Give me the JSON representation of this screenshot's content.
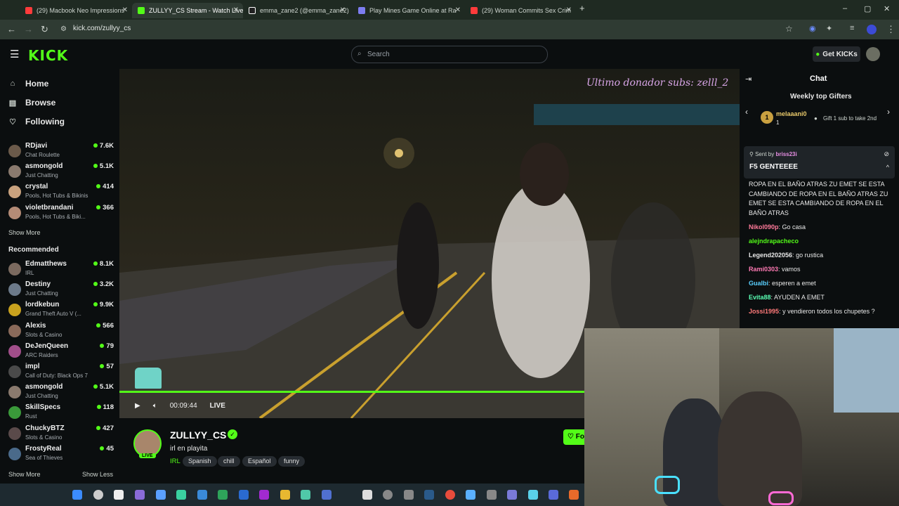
{
  "browser": {
    "tabs": [
      {
        "label": "(29) Macbook Neo Impressions",
        "favicon_color": "#ff3b3b"
      },
      {
        "label": "ZULLYY_CS Stream - Watch Live",
        "favicon_color": "#53fc18"
      },
      {
        "label": "emma_zane2 (@emma_zane2)",
        "favicon_color": "#ffffff"
      },
      {
        "label": "Play Mines Game Online at Ra",
        "favicon_color": "#7d7df0"
      },
      {
        "label": "(29) Woman Commits Sex Crim",
        "favicon_color": "#ff3b3b"
      }
    ],
    "new_tab": "+",
    "url": "kick.com/zullyy_cs",
    "window_controls": [
      "–",
      "▢",
      "✕"
    ]
  },
  "header": {
    "logo": "KICK",
    "search_placeholder": "Search",
    "get_kicks": "Get KICKs"
  },
  "sidebar": {
    "nav": [
      {
        "label": "Home",
        "icon": "home-icon"
      },
      {
        "label": "Browse",
        "icon": "browse-icon"
      },
      {
        "label": "Following",
        "icon": "heart-icon"
      }
    ],
    "following": [
      {
        "name": "RDjavi",
        "category": "Chat Roulette",
        "viewers": "7.6K",
        "color": "#6b5a4a"
      },
      {
        "name": "asmongold",
        "category": "Just Chatting",
        "viewers": "5.1K",
        "color": "#8a7a6e"
      },
      {
        "name": "crystal",
        "category": "Pools, Hot Tubs & Bikinis",
        "viewers": "414",
        "color": "#c9a27e"
      },
      {
        "name": "violetbrandani",
        "category": "Pools, Hot Tubs & Biki...",
        "viewers": "366",
        "color": "#b48b76"
      }
    ],
    "show_more_1": "Show More",
    "recommended_label": "Recommended",
    "recommended": [
      {
        "name": "Edmatthews",
        "category": "IRL",
        "viewers": "8.1K",
        "color": "#7b6a5f"
      },
      {
        "name": "Destiny",
        "category": "Just Chatting",
        "viewers": "3.2K",
        "color": "#6c7a8a"
      },
      {
        "name": "lordkebun",
        "category": "Grand Theft Auto V (...",
        "viewers": "9.9K",
        "color": "#c9a21e"
      },
      {
        "name": "Alexis",
        "category": "Slots & Casino",
        "viewers": "566",
        "color": "#8a6a5a"
      },
      {
        "name": "DeJenQueen",
        "category": "ARC Raiders",
        "viewers": "79",
        "color": "#a14e8a"
      },
      {
        "name": "impl",
        "category": "Call of Duty: Black Ops 7",
        "viewers": "57",
        "color": "#4a4a4a"
      },
      {
        "name": "asmongold",
        "category": "Just Chatting",
        "viewers": "5.1K",
        "color": "#8a7a6e"
      },
      {
        "name": "SkillSpecs",
        "category": "Rust",
        "viewers": "118",
        "color": "#3a9a3a"
      },
      {
        "name": "ChuckyBTZ",
        "category": "Slots & Casino",
        "viewers": "427",
        "color": "#5a4a4a"
      },
      {
        "name": "FrostyReal",
        "category": "Sea of Thieves",
        "viewers": "45",
        "color": "#4a6a8a"
      }
    ],
    "show_more_2": "Show More",
    "show_less": "Show Less"
  },
  "video": {
    "watermark": "Ultimo donador subs: zelll_2",
    "elapsed": "00:09:44",
    "live_label": "LIVE",
    "progress_fraction": 0.75
  },
  "stream": {
    "name": "ZULLYY_CS",
    "title": "irl en playita",
    "live_badge": "LIVE",
    "category": "IRL",
    "tags": [
      "Spanish",
      "chill",
      "Español",
      "funny"
    ],
    "follow_label": "Fo"
  },
  "chat": {
    "title": "Chat",
    "weekly_label": "Weekly top Gifters",
    "top_gifter": "melaaani0",
    "top_gifter_count": "1",
    "gift_cta": "Gift 1 sub to take 2nd",
    "pinned_by_label": "Sent by",
    "pinned_by_user": "briss23i",
    "pinned_message": "F5 GENTEEEE",
    "messages": [
      {
        "user": "",
        "text": "ROPA EN EL BAÑO ATRAS ZU EMET SE ESTA CAMBIANDO DE ROPA EN EL BAÑO ATRAS ZU EMET SE ESTA CAMBIANDO DE ROPA EN EL BAÑO ATRAS",
        "color": "#e8e8e8"
      },
      {
        "user": "Nikol090p",
        "text": "Go casa",
        "color": "#ff7a9a"
      },
      {
        "user": "alejndrapacheco",
        "text": "",
        "color": "#53fc18"
      },
      {
        "user": "Legend202056",
        "text": "go rustica",
        "color": "#e8e8e8"
      },
      {
        "user": "Rami0303",
        "text": "vamos",
        "color": "#ff7ab4"
      },
      {
        "user": "Gualbi",
        "text": "esperen a emet",
        "color": "#5ad0ff"
      },
      {
        "user": "Evita88",
        "text": "AYUDEN A EMET",
        "color": "#5affb4"
      },
      {
        "user": "Jossi1995",
        "text": "y vendieron todos los chupetes ?",
        "color": "#ff7a7a"
      }
    ]
  }
}
